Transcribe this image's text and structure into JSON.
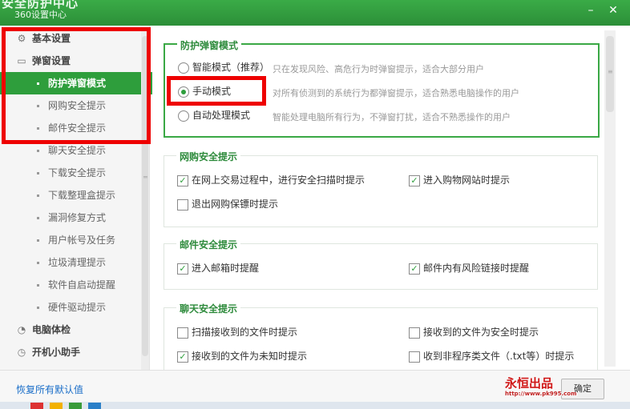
{
  "window": {
    "title_fragment": "安全防护中心",
    "subtitle": "360设置中心"
  },
  "sidebar": {
    "items": [
      {
        "label": "基本设置",
        "type": "category",
        "icon": "gear-icon"
      },
      {
        "label": "弹窗设置",
        "type": "category",
        "icon": "window-icon"
      },
      {
        "label": "防护弹窗模式",
        "type": "sub",
        "active": true
      },
      {
        "label": "网购安全提示",
        "type": "sub"
      },
      {
        "label": "邮件安全提示",
        "type": "sub"
      },
      {
        "label": "聊天安全提示",
        "type": "sub"
      },
      {
        "label": "下载安全提示",
        "type": "sub"
      },
      {
        "label": "下载整理盒提示",
        "type": "sub"
      },
      {
        "label": "漏洞修复方式",
        "type": "sub"
      },
      {
        "label": "用户帐号及任务",
        "type": "sub"
      },
      {
        "label": "垃圾清理提示",
        "type": "sub"
      },
      {
        "label": "软件自启动提醒",
        "type": "sub"
      },
      {
        "label": "硬件驱动提示",
        "type": "sub"
      },
      {
        "label": "电脑体检",
        "type": "category",
        "icon": "checkup-icon"
      },
      {
        "label": "开机小助手",
        "type": "category",
        "icon": "clock-icon"
      }
    ]
  },
  "protection_mode": {
    "title": "防护弹窗模式",
    "options": [
      {
        "label": "智能模式（推荐）",
        "desc": "只在发现风险、高危行为时弹窗提示，适合大部分用户",
        "selected": false
      },
      {
        "label": "手动模式",
        "desc": "对所有侦测到的系统行为都弹窗提示，适合熟悉电脑操作的用户",
        "selected": true
      },
      {
        "label": "自动处理模式",
        "desc": "智能处理电脑所有行为，不弹窗打扰，适合不熟悉操作的用户",
        "selected": false
      }
    ]
  },
  "shopping": {
    "title": "网购安全提示",
    "options": [
      {
        "label": "在网上交易过程中，进行安全扫描时提示",
        "checked": true
      },
      {
        "label": "进入购物网站时提示",
        "checked": true
      },
      {
        "label": "退出网购保镖时提示",
        "checked": false
      }
    ]
  },
  "email": {
    "title": "邮件安全提示",
    "options": [
      {
        "label": "进入邮箱时提醒",
        "checked": true
      },
      {
        "label": "邮件内有风险链接时提醒",
        "checked": true
      }
    ]
  },
  "chat": {
    "title": "聊天安全提示",
    "options": [
      {
        "label": "扫描接收到的文件时提示",
        "checked": false
      },
      {
        "label": "接收到的文件为安全时提示",
        "checked": false
      },
      {
        "label": "接收到的文件为未知时提示",
        "checked": true
      },
      {
        "label": "收到非程序类文件（.txt等）时提示",
        "checked": false
      }
    ]
  },
  "footer": {
    "reset_label": "恢复所有默认值",
    "ok_label": "确定"
  },
  "watermark": {
    "text": "永恒出品",
    "url": "http://www.pk995.com"
  },
  "colors": {
    "accent": "#2e9e3c",
    "highlight_box": "#ee0000",
    "link": "#1a6ec8"
  }
}
